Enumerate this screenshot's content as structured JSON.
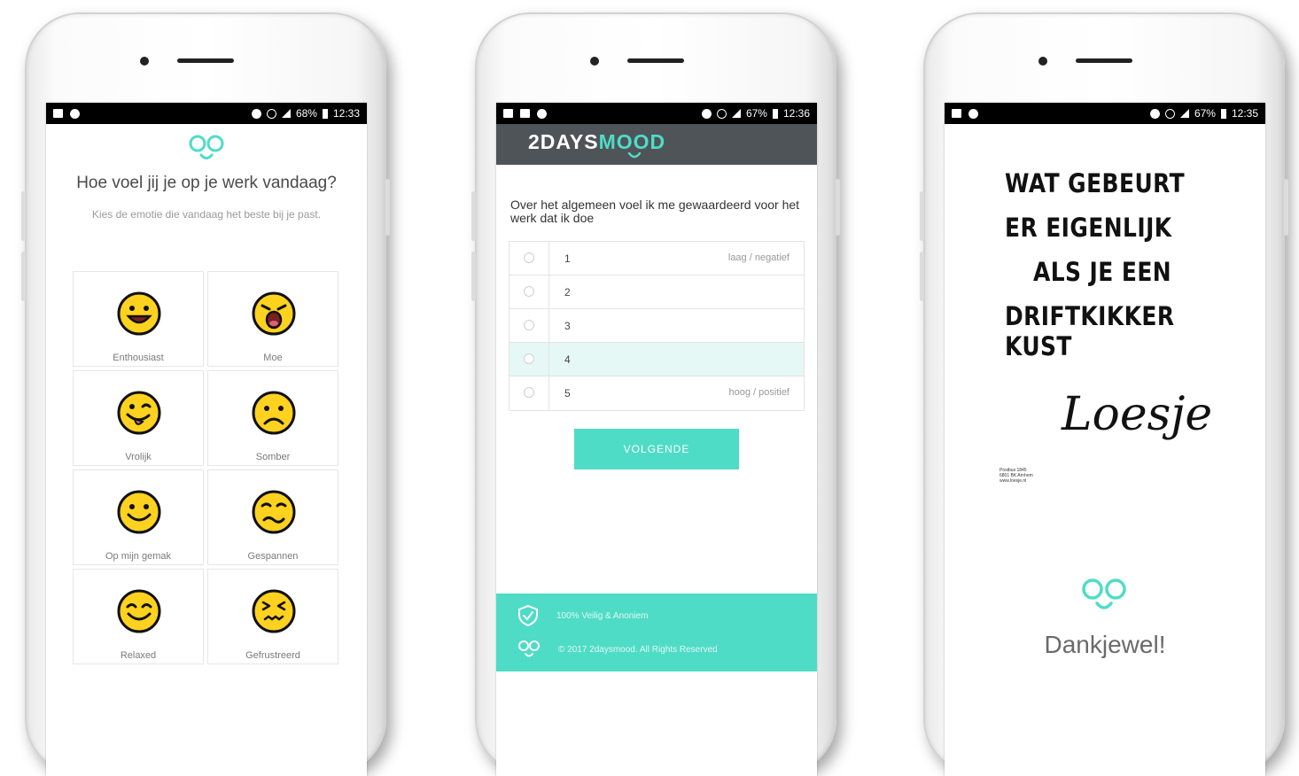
{
  "colors": {
    "accent": "#4fdcc6",
    "header": "#4f5459",
    "emoji": "#ffd21f",
    "selected_row": "#e6f8f5"
  },
  "screen1": {
    "status": {
      "battery": "68%",
      "time": "12:33"
    },
    "logo": "eyes-smile-logo",
    "title": "Hoe voel jij je op je werk vandaag?",
    "subtitle": "Kies de emotie die vandaag het beste bij je past.",
    "moods": [
      {
        "label": "Enthousiast",
        "icon": "grin-face-icon"
      },
      {
        "label": "Moe",
        "icon": "yawn-face-icon"
      },
      {
        "label": "Vrolijk",
        "icon": "tongue-face-icon"
      },
      {
        "label": "Somber",
        "icon": "sad-face-icon"
      },
      {
        "label": "Op mijn gemak",
        "icon": "smile-face-icon"
      },
      {
        "label": "Gespannen",
        "icon": "worried-face-icon"
      },
      {
        "label": "Relaxed",
        "icon": "relaxed-face-icon"
      },
      {
        "label": "Gefrustreerd",
        "icon": "frustrated-face-icon"
      }
    ]
  },
  "screen2": {
    "status": {
      "battery": "67%",
      "time": "12:36"
    },
    "brand": {
      "part1": "2DAYS",
      "part2": "MOOD"
    },
    "question": "Over het algemeen voel ik me gewaardeerd voor het werk dat ik doe",
    "options": [
      {
        "num": "1",
        "hint": "laag / negatief"
      },
      {
        "num": "2",
        "hint": ""
      },
      {
        "num": "3",
        "hint": ""
      },
      {
        "num": "4",
        "hint": ""
      },
      {
        "num": "5",
        "hint": "hoog / positief"
      }
    ],
    "selected_option": "4",
    "next_label": "VOLGENDE",
    "footer": {
      "line1": "100% Veilig & Anoniem",
      "line2": "© 2017 2daysmood. All Rights Reserved"
    }
  },
  "screen3": {
    "status": {
      "battery": "67%",
      "time": "12:35"
    },
    "poster_lines": [
      "WAT GEBEURT",
      "ER EIGENLIJK",
      "ALS JE EEN",
      "DRIFTKIKKER KUST"
    ],
    "signature": "Loesje",
    "address": [
      "Postbus 1845",
      "6801 BK Arnhem",
      "www.loesje.nl"
    ],
    "thanks": "Dankjewel!"
  }
}
